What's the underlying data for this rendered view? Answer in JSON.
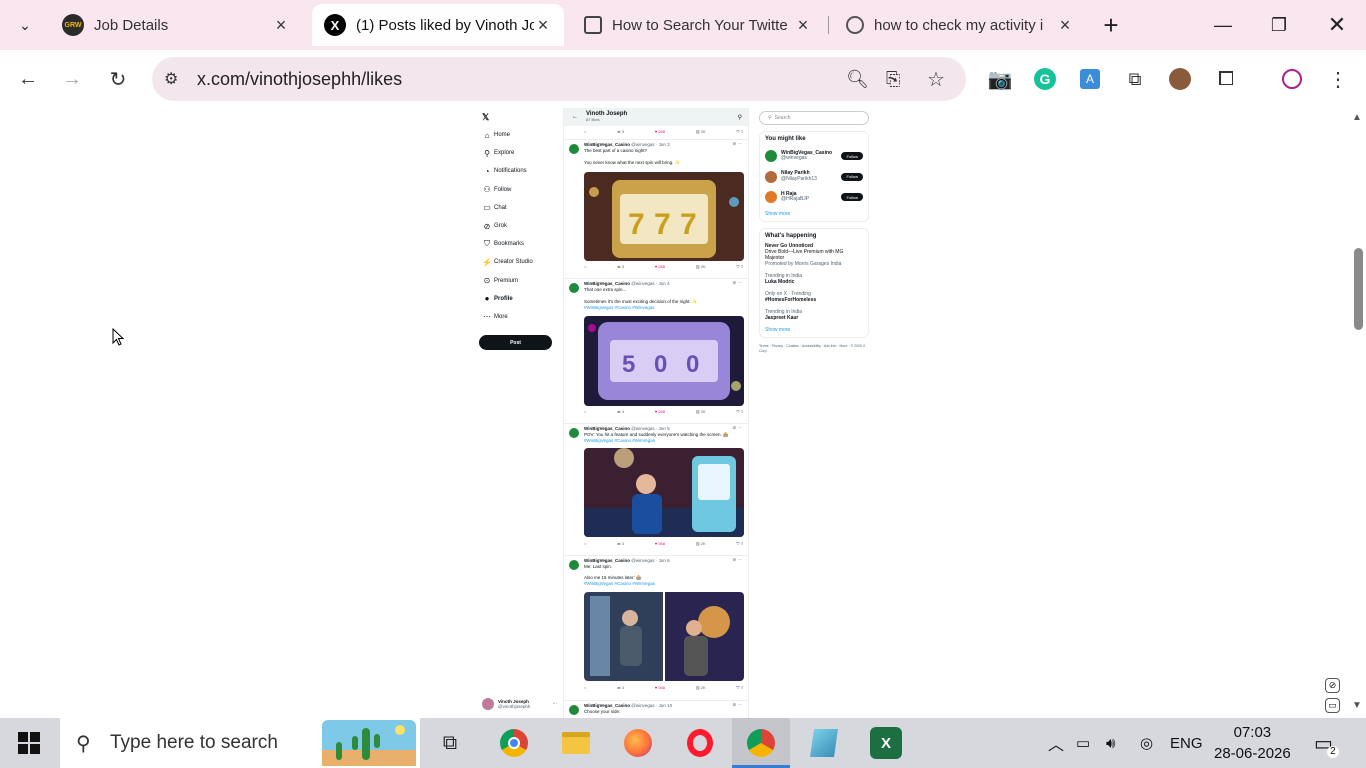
{
  "browser": {
    "tabs": [
      {
        "title": "Job Details",
        "favicon": "GRW"
      },
      {
        "title": "(1) Posts liked by Vinoth Jo",
        "favicon": "X"
      },
      {
        "title": "How to Search Your Twitte",
        "favicon": "doc"
      },
      {
        "title": "how to check my activity i",
        "favicon": "web"
      }
    ],
    "url": "x.com/vinothjosephh/likes"
  },
  "x_page": {
    "nav_items": [
      "Home",
      "Explore",
      "Notifications",
      "Follow",
      "Chat",
      "Grok",
      "Bookmarks",
      "Creator Studio",
      "Premium",
      "Profile",
      "More"
    ],
    "post_label": "Post",
    "profile_name": "Vinoth Joseph",
    "profile_handle": "@vinothjosephh",
    "header_name": "Vinoth Joseph",
    "header_sub": "87 likes",
    "top_actions": {
      "retweets": "3",
      "likes": "268",
      "views": "2K"
    },
    "tweets": [
      {
        "author": "WinBigVegas_Casino",
        "handle": "@winvegas · Jun 3",
        "text": "The best part of a casino night?",
        "text2": "You never know what the next spin will bring. ✨",
        "tags": "",
        "replies": "",
        "retweets": "3",
        "likes": "268",
        "views": "2K"
      },
      {
        "author": "WinBigVegas_Casino",
        "handle": "@winvegas · Jun 4",
        "text": "That one extra spin...",
        "text2": "Sometimes it's the most exciting decision of the night. ✨",
        "tags": "#WinBigVegas #Casino #Winvegas",
        "replies": "",
        "retweets": "4",
        "likes": "268",
        "views": "2K"
      },
      {
        "author": "WinBigVegas_Casino",
        "handle": "@winvegas · Jun 5",
        "text": "POV: You hit a feature and suddenly everyone's watching the screen. 🎰",
        "text2": "",
        "tags": "#WinBigVegas #Casino #WinVegas",
        "replies": "",
        "retweets": "3",
        "likes": "268",
        "views": "2K"
      },
      {
        "author": "WinBigVegas_Casino",
        "handle": "@winvegas · Jun 6",
        "text": "Me: Last spin.",
        "text2": "Also me 15 minutes later: 🎰",
        "tags": "#WinBigVegas #Casino #WinVegas",
        "replies": "",
        "retweets": "3",
        "likes": "268",
        "views": "2K"
      },
      {
        "author": "WinBigVegas_Casino",
        "handle": "@winvegas · Jun 10",
        "text": "Choose your side:",
        "text2": "",
        "tags": "",
        "replies": "",
        "retweets": "",
        "likes": "",
        "views": ""
      }
    ],
    "search_placeholder": "Search",
    "you_might_like": {
      "title": "You might like",
      "accounts": [
        {
          "name": "WinBigVegas_Casino",
          "handle": "@winvegas",
          "color": "#1f8a3c"
        },
        {
          "name": "Nilay Parikh",
          "handle": "@NilayParikh13",
          "color": "#b56a3e"
        },
        {
          "name": "H Raja",
          "handle": "@HRajaBJP",
          "color": "#e07a28"
        }
      ],
      "follow_label": "Follow",
      "show_more": "Show more"
    },
    "whats_happening": {
      "title": "What's happening",
      "items": [
        {
          "title": "Never Go Unnoticed",
          "sub": "Drive Bold—Live Premium with MG Majestor",
          "note": "Promoted by Morris Garages India"
        },
        {
          "meta": "Trending in India",
          "title": "Luka Modric"
        },
        {
          "meta": "Only on X · Trending",
          "title": "#HomesForHomeless"
        },
        {
          "meta": "Trending in India",
          "title": "Jaspreet Kaur"
        }
      ],
      "show_more": "Show more"
    },
    "footer_links": "Terms · Privacy · Cookies · Accessibility · Ads info · More · © 2026 X Corp."
  },
  "taskbar": {
    "search_placeholder": "Type here to search",
    "lang": "ENG",
    "time": "07:03",
    "date": "28-06-2026",
    "notifications": "2"
  }
}
